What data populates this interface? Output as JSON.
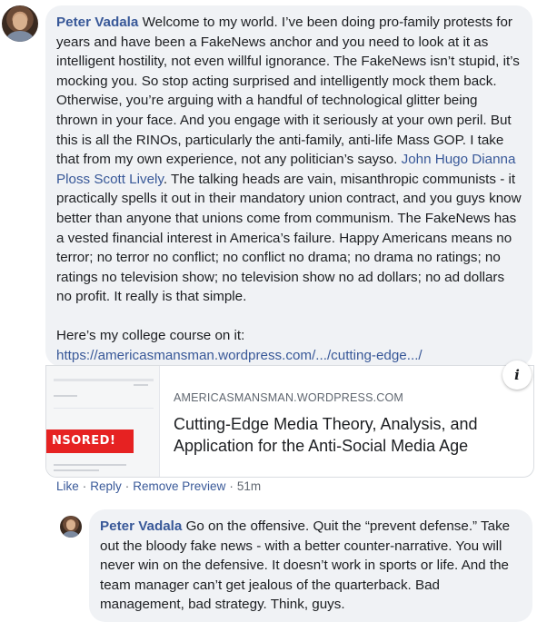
{
  "comment": {
    "author": "Peter Vadala",
    "text_part1": " Welcome to my world. I’ve been doing pro-family protests for years and have been a FakeNews anchor and you need to look at it as intelligent hostility, not even willful ignorance. The FakeNews isn’t stupid, it’s mocking you. So stop acting surprised and intelligently mock them back. Otherwise, you’re arguing with a handful of technological glitter being thrown in your face. And you engage with it seriously at your own peril. But this is all the RINOs, particularly the anti-family, anti-life Mass GOP. I take that from my own experience, not any politician’s sayso. ",
    "tagged": "John Hugo Dianna Ploss Scott Lively",
    "text_part2": ". The talking heads are vain, misanthropic communists - it practically spells it out in their mandatory union contract, and you guys know better than anyone that unions come from communism. The FakeNews has a vested financial interest in America’s failure. Happy Americans means no terror; no terror no conflict; no conflict no drama; no drama no ratings; no ratings no television show; no television show no ad dollars; no ad dollars no profit. It really is that simple.",
    "course_text": "Here’s my college course on it:",
    "course_link": "https://americasmansman.wordpress.com/.../cutting-edge.../"
  },
  "preview": {
    "site": "AMERICASMANSMAN.WORDPRESS.COM",
    "title": "Cutting-Edge Media Theory, Analysis, and Application for the Anti-Social Media Age",
    "thumb_stamp": "NSORED!",
    "info_label": "i"
  },
  "actions": {
    "like": "Like",
    "reply": "Reply",
    "remove_preview": "Remove Preview",
    "time": "51m",
    "sep": "·"
  },
  "reply": {
    "author": "Peter Vadala",
    "text": " Go on the offensive. Quit the “prevent defense.” Take out the bloody fake news - with a better counter-narrative. You will never win on the defensive. It doesn’t work in sports or life. And the team manager can’t get jealous of the quarterback. Bad management, bad strategy. Think, guys."
  }
}
